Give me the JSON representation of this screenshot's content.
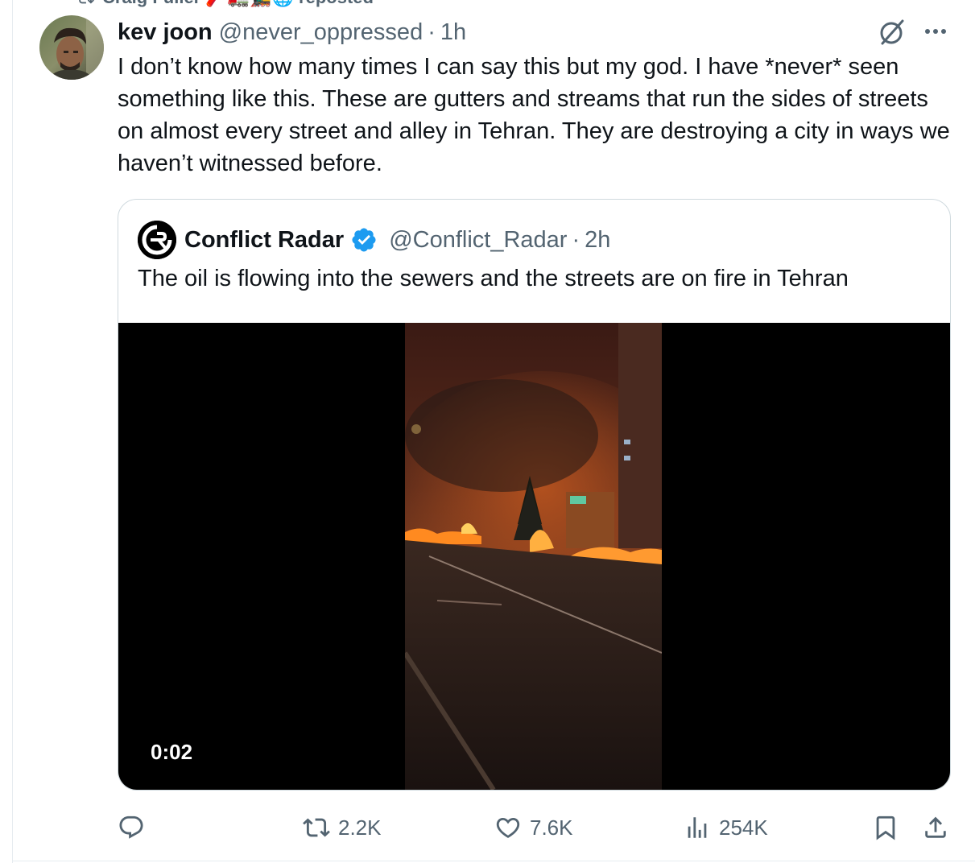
{
  "repost_banner": {
    "text": "Craig Fuller 🧨🚛🚂🌐 reposted"
  },
  "tweet": {
    "display_name": "kev joon",
    "handle": "@never_oppressed",
    "separator": "·",
    "time": "1h",
    "text": "I don’t know how many times I can say this but my god. I have *never* seen something like this. These are gutters and streams that run the sides of streets on almost every street and alley in Tehran. They are destroying a city in ways we haven’t witnessed before."
  },
  "quote": {
    "display_name": "Conflict Radar",
    "handle": "@Conflict_Radar",
    "separator": "·",
    "time": "2h",
    "text": "The oil is flowing into the sewers and the streets are on fire in Tehran",
    "video_time": "0:02"
  },
  "actions": {
    "reply": {
      "icon": "reply-icon",
      "count": ""
    },
    "repost": {
      "icon": "repost-icon",
      "count": "2.2K"
    },
    "like": {
      "icon": "heart-icon",
      "count": "7.6K"
    },
    "views": {
      "icon": "views-icon",
      "count": "254K"
    },
    "bookmark": {
      "icon": "bookmark-icon"
    },
    "share": {
      "icon": "share-icon"
    }
  },
  "colors": {
    "text_primary": "#0f1419",
    "text_secondary": "#536471",
    "verified_blue": "#1d9bf0",
    "border": "#cfd9de"
  }
}
